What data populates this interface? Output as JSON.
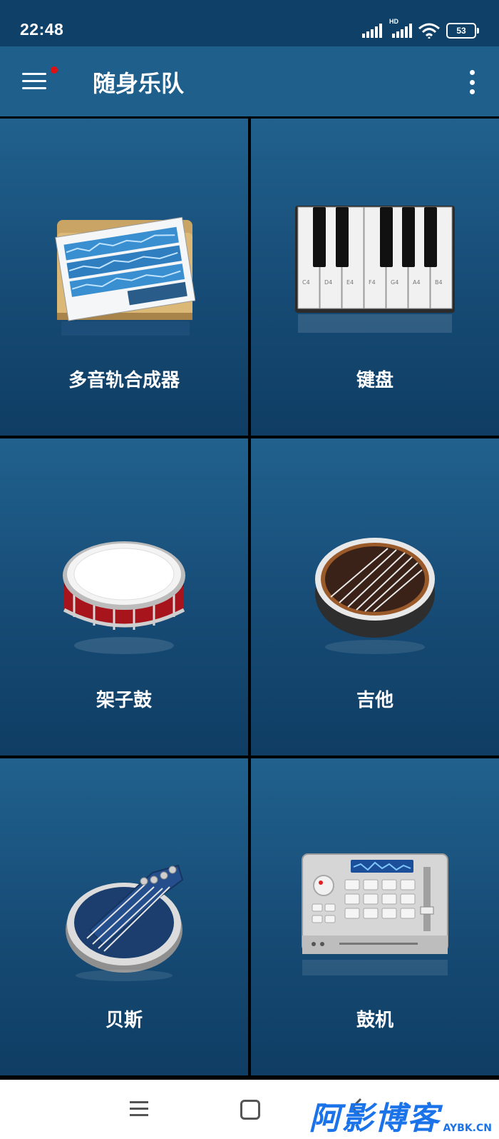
{
  "status_bar": {
    "time": "22:48",
    "network_label": "HD",
    "battery": "53"
  },
  "app_bar": {
    "title": "随身乐队"
  },
  "tiles": [
    {
      "label": "多音轨合成器",
      "icon": "multitrack-sequencer-icon"
    },
    {
      "label": "键盘",
      "icon": "piano-keyboard-icon"
    },
    {
      "label": "架子鼓",
      "icon": "snare-drum-icon"
    },
    {
      "label": "吉他",
      "icon": "guitar-icon"
    },
    {
      "label": "贝斯",
      "icon": "bass-icon"
    },
    {
      "label": "鼓机",
      "icon": "drum-machine-icon"
    }
  ],
  "piano_key_labels": [
    "C4",
    "D4",
    "E4",
    "F4",
    "G4",
    "A4",
    "B4"
  ],
  "watermark": {
    "main": "阿影博客",
    "sub": "AYBK.CN"
  },
  "colors": {
    "accent": "#1e5f8c",
    "tile_top": "#21618e",
    "tile_bottom": "#0f3d63",
    "badge": "#dd1111",
    "watermark": "#1a73e8"
  }
}
